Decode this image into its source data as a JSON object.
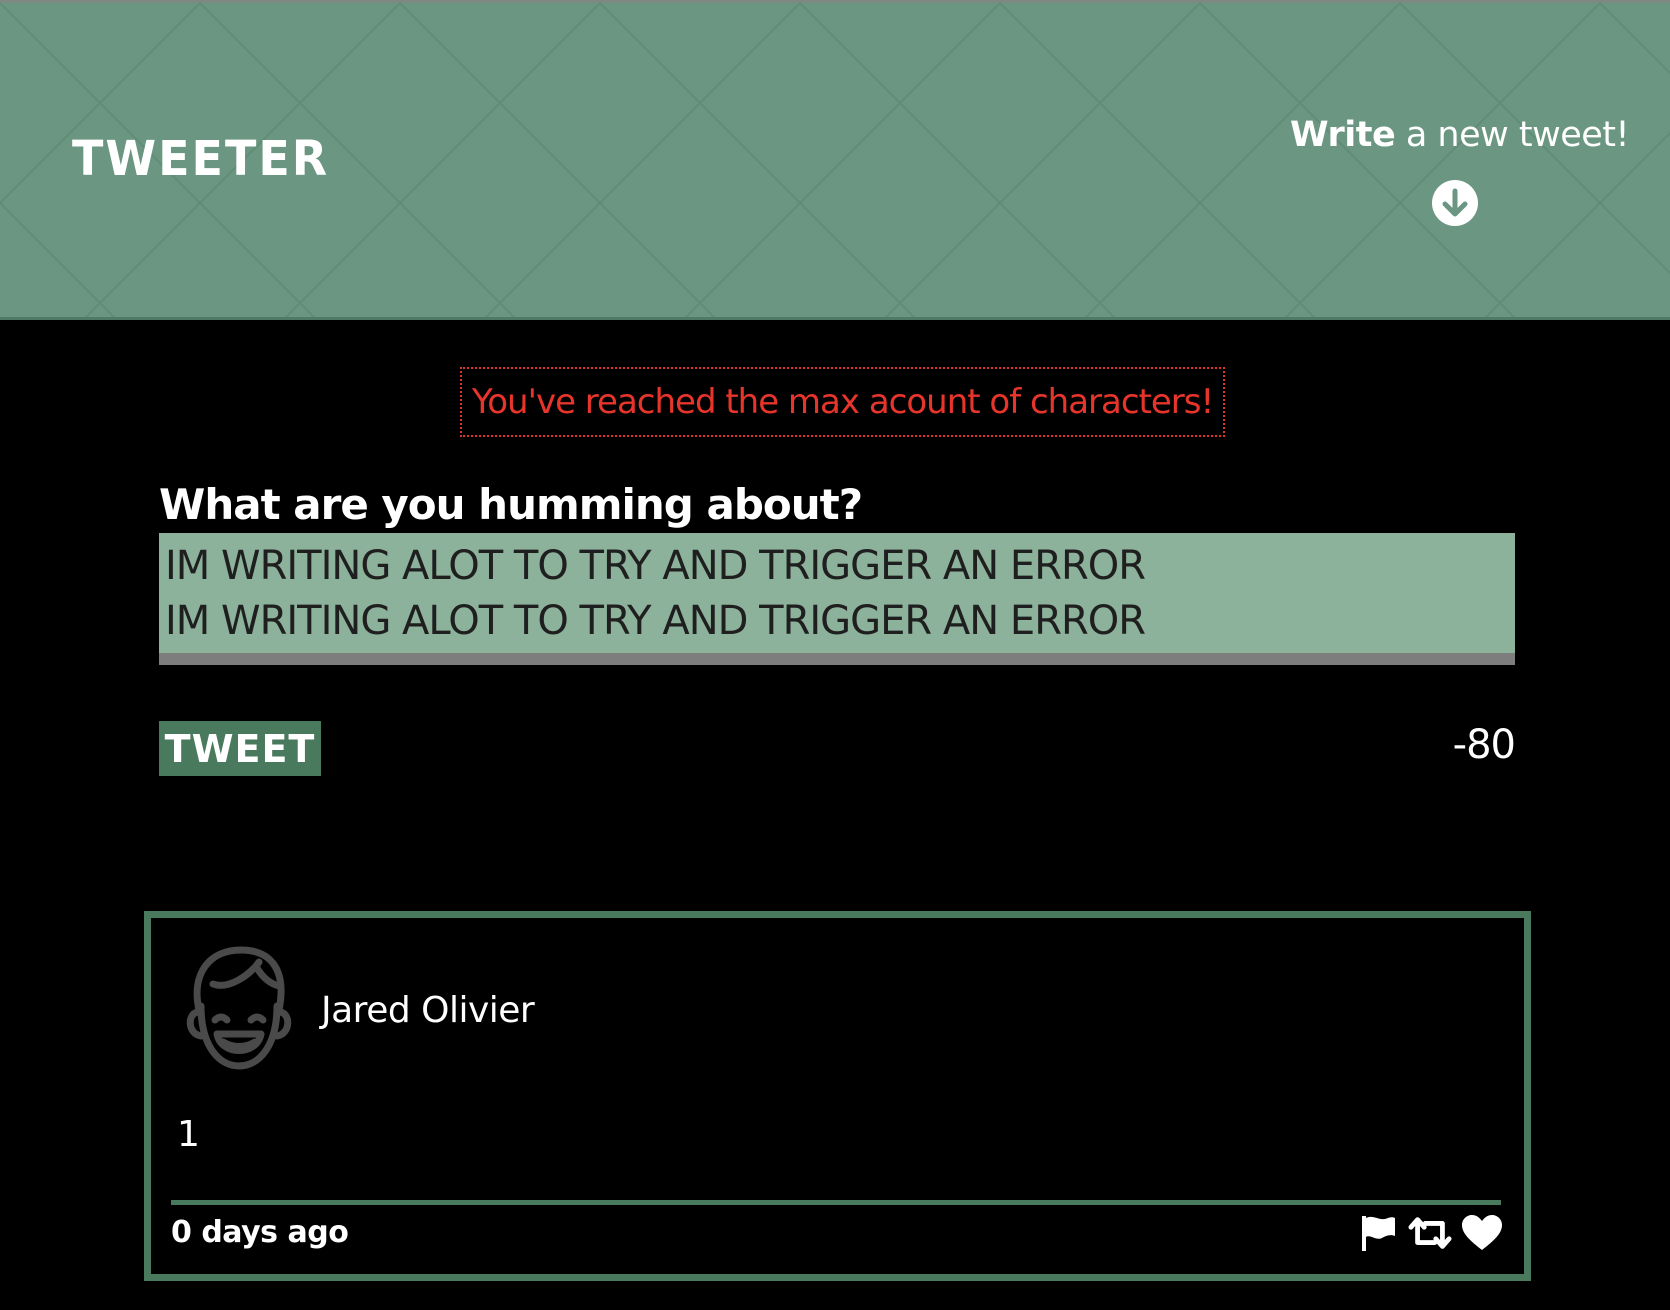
{
  "header": {
    "brand": "TWEETER",
    "compose_toggle": {
      "bold": "Write",
      "rest": " a new tweet!",
      "icon": "arrow-down-circle-icon"
    },
    "background_color": "#6a9682"
  },
  "compose": {
    "error_message": "You've reached the max acount of characters!",
    "label": "What are you humming about?",
    "textarea_value": "IM WRITING ALOT TO TRY AND TRIGGER AN ERROR\nIM WRITING ALOT TO TRY AND TRIGGER AN ERROR",
    "submit_label": "TWEET",
    "char_counter": "-80"
  },
  "tweets": [
    {
      "author": "Jared Olivier",
      "avatar_icon": "face-avatar-icon",
      "content": "1",
      "timestamp": "0 days ago",
      "actions": [
        "flag-icon",
        "retweet-icon",
        "heart-icon"
      ]
    }
  ],
  "colors": {
    "accent": "#4a7a5e",
    "textarea_bg": "#8cb29b",
    "error": "#e8352b",
    "page_bg": "#000000"
  }
}
